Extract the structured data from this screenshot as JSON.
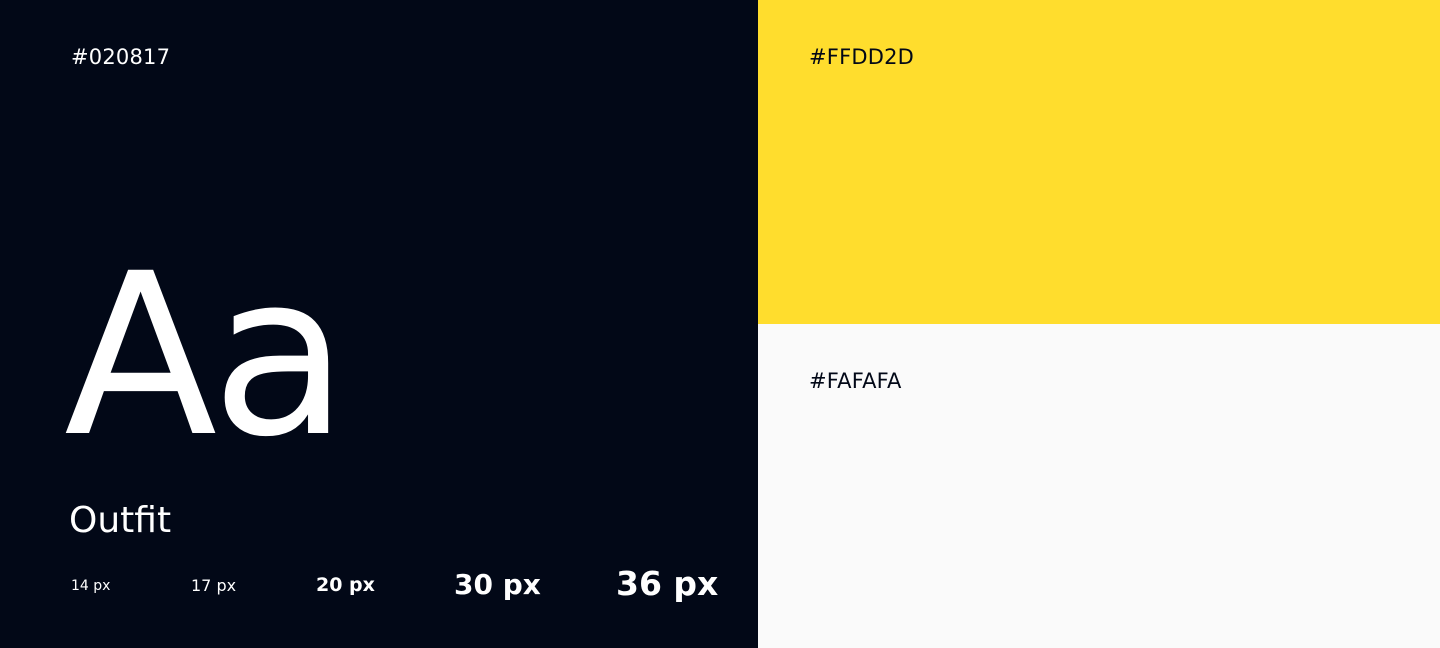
{
  "palette": {
    "dark": {
      "hex_label": "#020817",
      "color": "#020817"
    },
    "accent": {
      "hex_label": "#FFDD2D",
      "color": "#FFDD2D"
    },
    "light": {
      "hex_label": "#FAFAFA",
      "color": "#FAFAFA"
    }
  },
  "typography": {
    "specimen": "Aa",
    "font_name": "Outfit",
    "sizes": [
      "14 px",
      "17 px",
      "20 px",
      "30 px",
      "36 px"
    ]
  }
}
